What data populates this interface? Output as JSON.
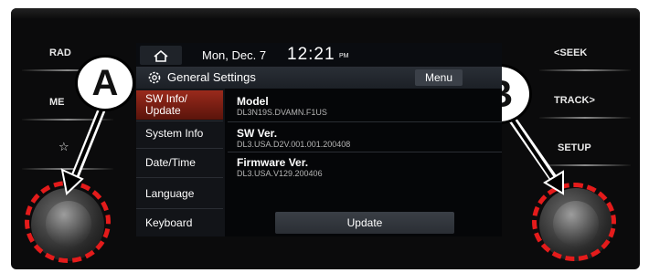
{
  "side_buttons_left": [
    "RAD",
    "ME",
    "☆"
  ],
  "side_buttons_right": [
    "<SEEK",
    "TRACK>",
    "SETUP"
  ],
  "callouts": {
    "a": "A",
    "b": "B"
  },
  "status": {
    "date": "Mon, Dec. 7",
    "time": "12:21",
    "ampm": "PM"
  },
  "header": {
    "title": "General Settings",
    "menu_label": "Menu"
  },
  "sidebar": {
    "items": [
      {
        "label_line1": "SW Info/",
        "label_line2": "Update"
      },
      {
        "label_line1": "System Info",
        "label_line2": ""
      },
      {
        "label_line1": "Date/Time",
        "label_line2": ""
      },
      {
        "label_line1": "Language",
        "label_line2": ""
      },
      {
        "label_line1": "Keyboard",
        "label_line2": ""
      }
    ]
  },
  "info": {
    "rows": [
      {
        "label": "Model",
        "value": "DL3N19S.DVAMN.F1US"
      },
      {
        "label": "SW Ver.",
        "value": "DL3.USA.D2V.001.001.200408"
      },
      {
        "label": "Firmware Ver.",
        "value": "DL3.USA.V129.200406"
      }
    ]
  },
  "update_label": "Update",
  "colors": {
    "active_tab": "#9a2a1c",
    "highlight": "#e41b1b"
  }
}
